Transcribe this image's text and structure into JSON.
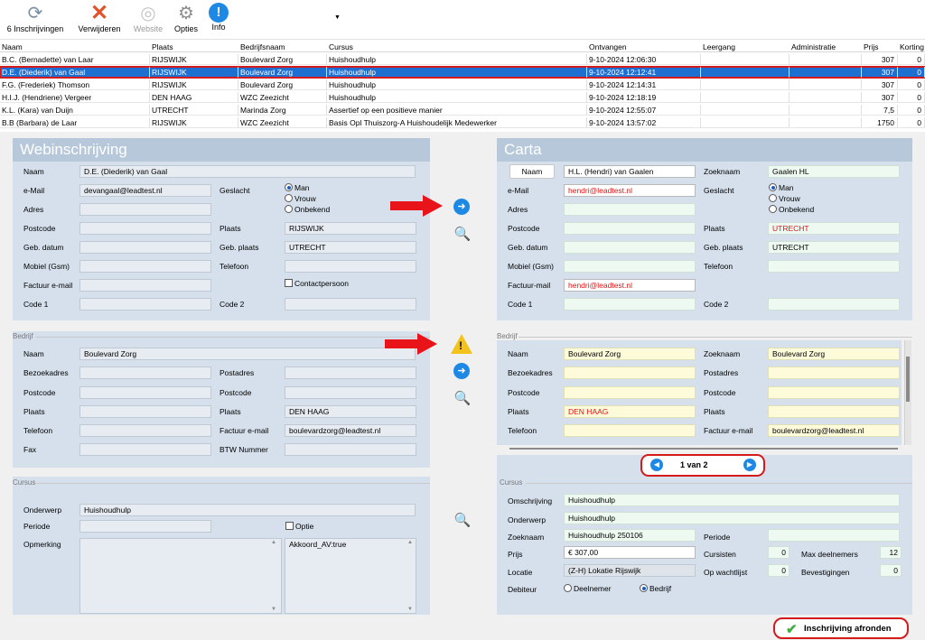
{
  "toolbar": {
    "inschrijvingen": "6 Inschrijvingen",
    "verwijderen": "Verwijderen",
    "website": "Website",
    "opties": "Opties",
    "info": "Info"
  },
  "grid": {
    "headers": [
      "Naam",
      "Plaats",
      "Bedrijfsnaam",
      "Cursus",
      "Ontvangen",
      "Leergang",
      "Administratie",
      "Prijs",
      "Korting"
    ],
    "rows": [
      [
        "B.C. (Bernadette) van Laar",
        "RIJSWIJK",
        "Boulevard Zorg",
        "Huishoudhulp",
        "9-10-2024 12:06:30",
        "",
        "",
        "307",
        "0"
      ],
      [
        "D.E. (Diederik) van Gaal",
        "RIJSWIJK",
        "Boulevard Zorg",
        "Huishoudhulp",
        "9-10-2024 12:12:41",
        "",
        "",
        "307",
        "0"
      ],
      [
        "F.G. (Frederiek) Thomson",
        "RIJSWIJK",
        "Boulevard Zorg",
        "Huishoudhulp",
        "9-10-2024 12:14:31",
        "",
        "",
        "307",
        "0"
      ],
      [
        "H.I.J. (Hendriene) Vergeer",
        "DEN HAAG",
        "WZC Zeezicht",
        "Huishoudhulp",
        "9-10-2024 12:18:19",
        "",
        "",
        "307",
        "0"
      ],
      [
        "K.L. (Kara) van Duijn",
        "UTRECHT",
        "Marinda Zorg",
        "Assertief op een positieve manier",
        "9-10-2024 12:55:07",
        "",
        "",
        "7,5",
        "0"
      ],
      [
        "B.B (Barbara) de Laar",
        "RIJSWIJK",
        "WZC Zeezicht",
        "Basis Opl Thuiszorg-A Huishoudelijk Medewerker",
        "9-10-2024 13:57:02",
        "",
        "",
        "1750",
        "0"
      ]
    ]
  },
  "web": {
    "title": "Webinschrijving",
    "naam_label": "Naam",
    "naam": "D.E. (Diederik) van Gaal",
    "email_label": "e-Mail",
    "email": "devangaal@leadtest.nl",
    "geslacht_label": "Geslacht",
    "gender_options": [
      "Man",
      "Vrouw",
      "Onbekend"
    ],
    "adres_label": "Adres",
    "postcode_label": "Postcode",
    "plaats_label": "Plaats",
    "plaats": "RIJSWIJK",
    "gebdatum_label": "Geb. datum",
    "gebplaats_label": "Geb. plaats",
    "gebplaats": "UTRECHT",
    "mobiel_label": "Mobiel (Gsm)",
    "telefoon_label": "Telefoon",
    "factuur_label": "Factuur e-mail",
    "contact_label": "Contactpersoon",
    "code1_label": "Code 1",
    "code2_label": "Code 2",
    "bedrijf_section": "Bedrijf",
    "b_naam_label": "Naam",
    "b_naam": "Boulevard Zorg",
    "bezoekadres_label": "Bezoekadres",
    "postadres_label": "Postadres",
    "b_postcode_label": "Postcode",
    "b_postcode2_label": "Postcode",
    "b_plaats_label": "Plaats",
    "b_plaats2_label": "Plaats",
    "b_plaats2": "DEN HAAG",
    "b_telefoon_label": "Telefoon",
    "b_factuur_label": "Factuur e-mail",
    "b_factuur": "boulevardzorg@leadtest.nl",
    "fax_label": "Fax",
    "btw_label": "BTW Nummer",
    "cursus_section": "Cursus",
    "onderwerp_label": "Onderwerp",
    "onderwerp": "Huishoudhulp",
    "periode_label": "Periode",
    "optie_label": "Optie",
    "opmerking_label": "Opmerking",
    "opmerking2": "Akkoord_AV:true"
  },
  "carta": {
    "title": "Carta",
    "naam_btn": "Naam",
    "naam": "H.L. (Hendri) van Gaalen",
    "zoeknaam_label": "Zoeknaam",
    "zoeknaam": "Gaalen HL",
    "email_label": "e-Mail",
    "email": "hendri@leadtest.nl",
    "geslacht_label": "Geslacht",
    "gender_options": [
      "Man",
      "Vrouw",
      "Onbekend"
    ],
    "adres_label": "Adres",
    "postcode_label": "Postcode",
    "plaats_label": "Plaats",
    "plaats": "UTRECHT",
    "gebdatum_label": "Geb. datum",
    "gebplaats_label": "Geb. plaats",
    "gebplaats": "UTRECHT",
    "mobiel_label": "Mobiel (Gsm)",
    "telefoon_label": "Telefoon",
    "factuur_label": "Factuur-mail",
    "factuur": "hendri@leadtest.nl",
    "code1_label": "Code 1",
    "code2_label": "Code 2",
    "bedrijf_section": "Bedrijf",
    "b_naam_label": "Naam",
    "b_naam": "Boulevard Zorg",
    "b_zoeknaam_label": "Zoeknaam",
    "b_zoeknaam": "Boulevard Zorg",
    "bezoekadres_label": "Bezoekadres",
    "postadres_label": "Postadres",
    "b_postcode_label": "Postcode",
    "b_postcode2_label": "Postcode",
    "b_plaats_label": "Plaats",
    "b_plaats": "DEN HAAG",
    "b_plaats2_label": "Plaats",
    "b_telefoon_label": "Telefoon",
    "b_factuur_label": "Factuur e-mail",
    "b_factuur": "boulevardzorg@leadtest.nl",
    "pager": "1 van 2",
    "cursus_section": "Cursus",
    "omschrijving_label": "Omschrijving",
    "omschrijving": "Huishoudhulp",
    "onderwerp_label": "Onderwerp",
    "onderwerp": "Huishoudhulp",
    "c_zoeknaam_label": "Zoeknaam",
    "c_zoeknaam": "Huishoudhulp 250106",
    "periode_label": "Periode",
    "prijs_label": "Prijs",
    "prijs": "€ 307,00",
    "cursisten_label": "Cursisten",
    "cursisten": "0",
    "maxdeel_label": "Max deelnemers",
    "maxdeel": "12",
    "locatie_label": "Locatie",
    "locatie": "(Z-H) Lokatie Rijswijk",
    "wachtlijst_label": "Op wachtlijst",
    "wachtlijst": "0",
    "bevestigingen_label": "Bevestigingen",
    "bevestigingen": "0",
    "debiteur_label": "Debiteur",
    "deelnemer": "Deelnemer",
    "bedrijf_opt": "Bedrijf"
  },
  "finish_label": "Inschrijving afronden",
  "colors": {
    "selection": "#1f6fd1",
    "highlight": "#d41a1a",
    "panel": "#d5e0ec",
    "title": "#b7c8da",
    "arrow": "#e8141a",
    "info": "#1e88e5"
  }
}
